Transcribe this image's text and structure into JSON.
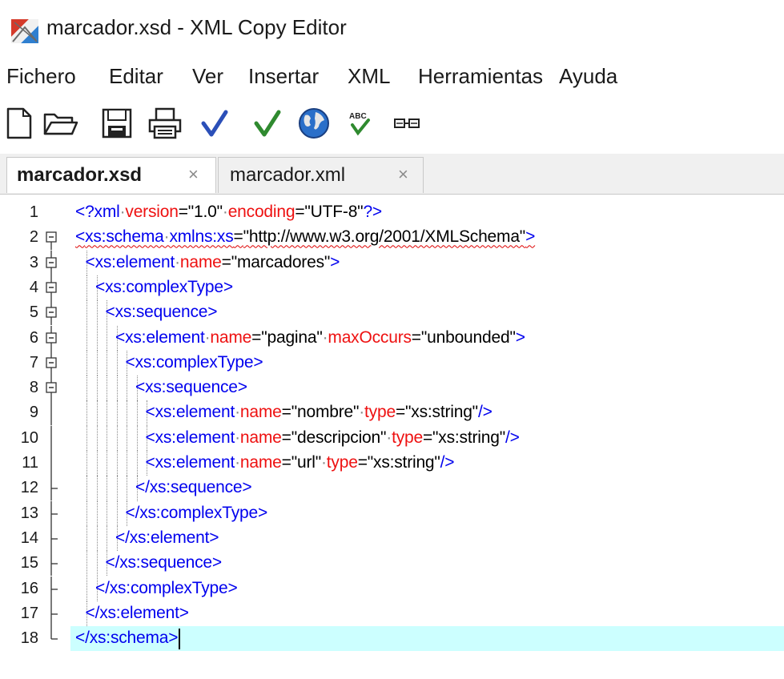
{
  "window": {
    "title": "marcador.xsd - XML Copy Editor"
  },
  "menu": {
    "items": [
      "Fichero",
      "Editar",
      "Ver",
      "Insertar",
      "XML",
      "Herramientas",
      "Ayuda"
    ]
  },
  "toolbar": {
    "buttons": [
      "new-file-icon",
      "open-folder-icon",
      "save-icon",
      "print-icon",
      "check-wellformed-icon",
      "validate-icon",
      "browser-globe-icon",
      "spellcheck-icon",
      "xml-tags-icon"
    ]
  },
  "tabs": [
    {
      "label": "marcador.xsd",
      "active": true
    },
    {
      "label": "marcador.xml",
      "active": false
    }
  ],
  "tab_close_glyph": "×",
  "editor": {
    "line_numbers": [
      "1",
      "2",
      "3",
      "4",
      "5",
      "6",
      "7",
      "8",
      "9",
      "10",
      "11",
      "12",
      "13",
      "14",
      "15",
      "16",
      "17",
      "18"
    ],
    "current_line": 18,
    "lines": [
      "<?xml version=\"1.0\" encoding=\"UTF-8\"?>",
      "<xs:schema xmlns:xs=\"http://www.w3.org/2001/XMLSchema\">",
      "<xs:element name=\"marcadores\">",
      "<xs:complexType>",
      "<xs:sequence>",
      "<xs:element name=\"pagina\" maxOccurs=\"unbounded\">",
      "<xs:complexType>",
      "<xs:sequence>",
      "<xs:element name=\"nombre\" type=\"xs:string\"/>",
      "<xs:element name=\"descripcion\" type=\"xs:string\"/>",
      "<xs:element name=\"url\" type=\"xs:string\"/>",
      "</xs:sequence>",
      "</xs:complexType>",
      "</xs:element>",
      "</xs:sequence>",
      "</xs:complexType>",
      "</xs:element>",
      "</xs:schema>"
    ]
  },
  "colors": {
    "tag": "#0000ee",
    "attribute": "#ee1111",
    "value": "#000000",
    "current_line_bg": "#ccffff"
  }
}
